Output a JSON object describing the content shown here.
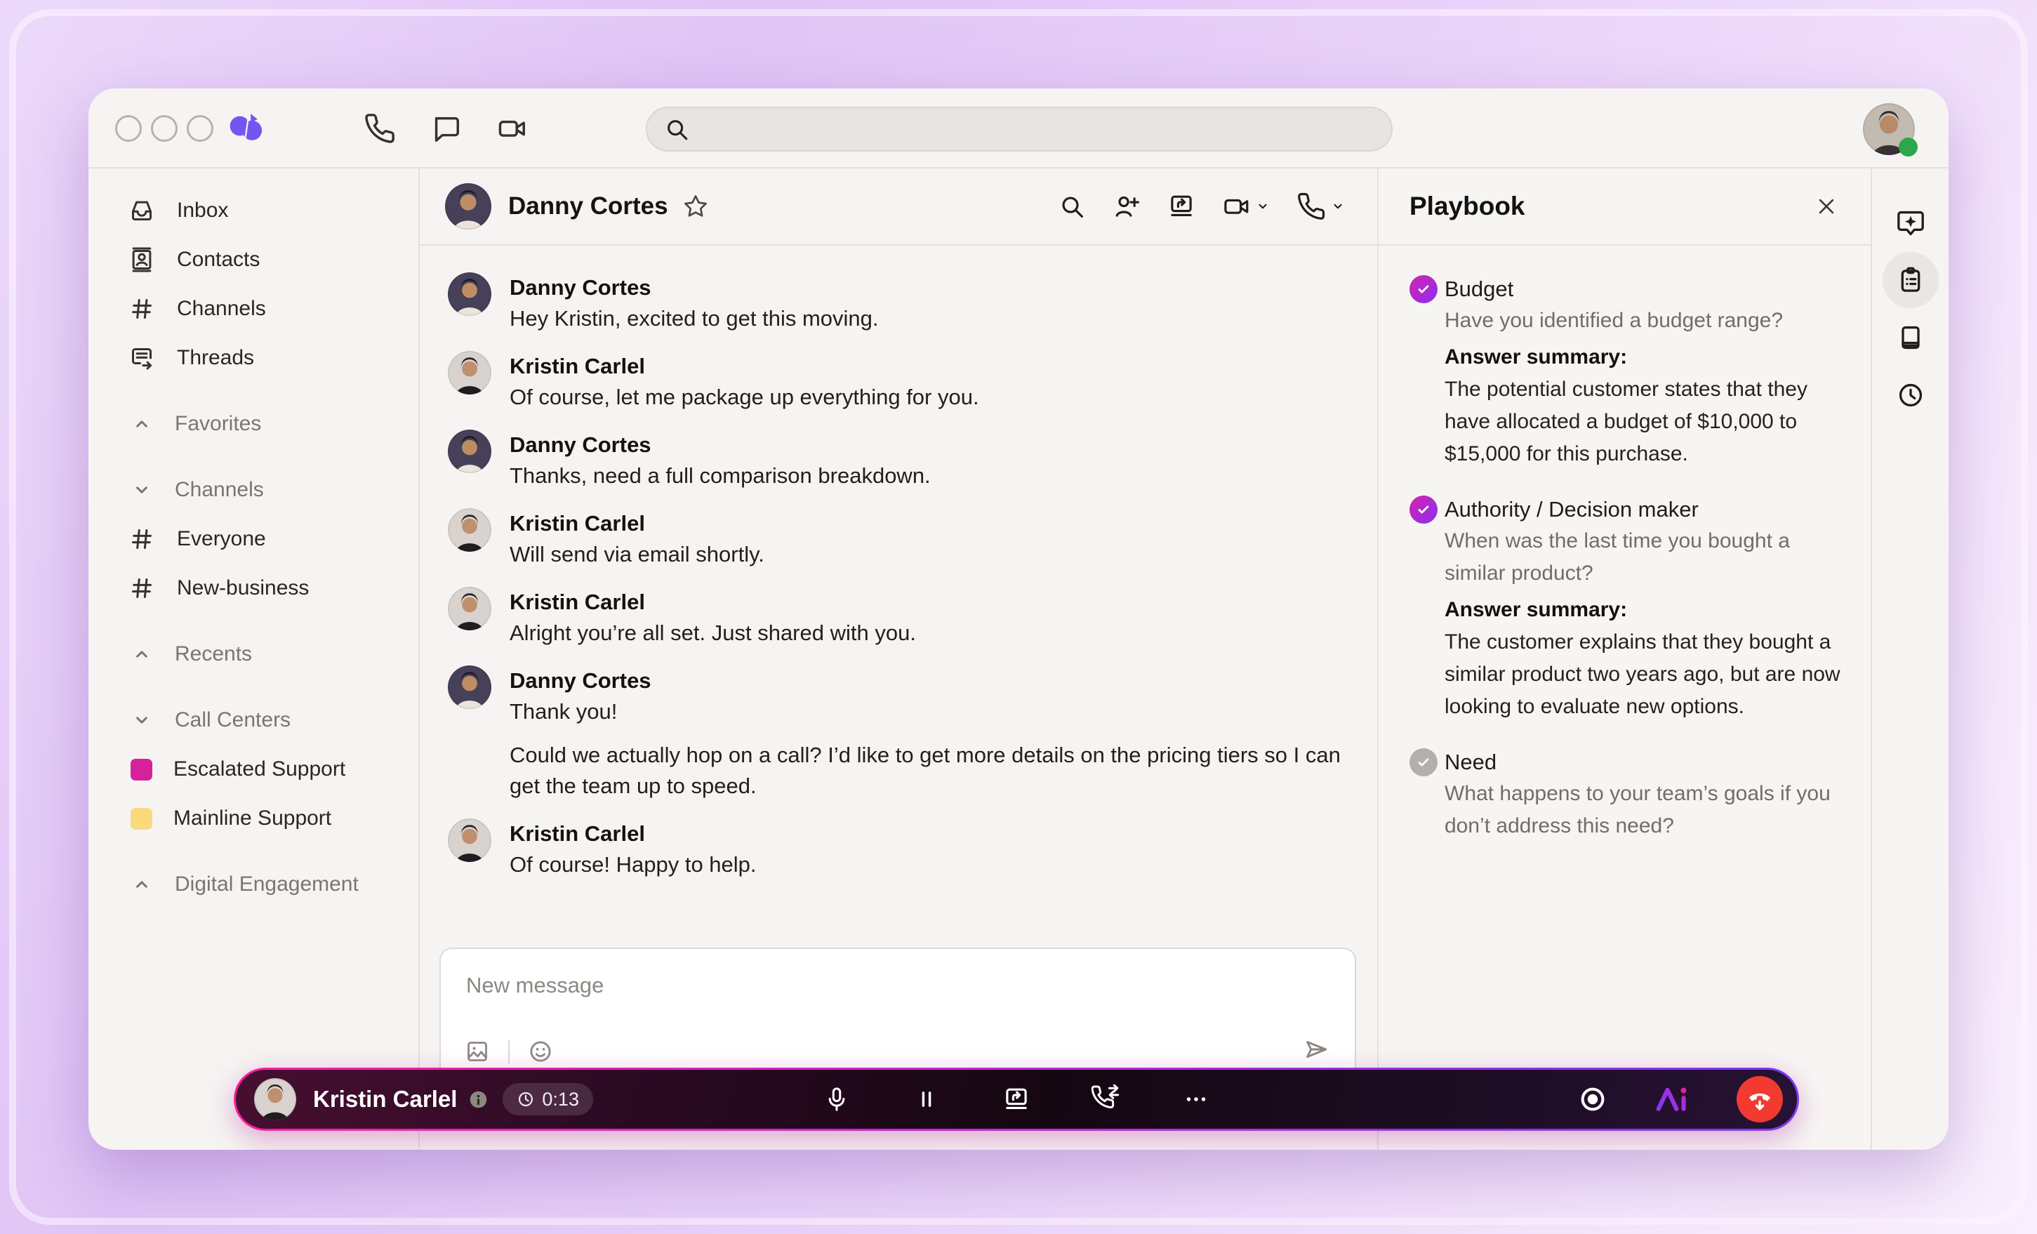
{
  "colors": {
    "accent": "#7356f2",
    "magenta": "#d6219c",
    "yellow": "#fbd97f",
    "presence_green": "#2ba84a",
    "hangup_red": "#f23a31",
    "check_gradient_start": "#d424ae",
    "check_gradient_end": "#8b2ff0",
    "callbar_border_start": "#ff1fa0",
    "callbar_border_end": "#7b3bf5"
  },
  "topbar": {
    "nav_icons": [
      {
        "name": "phone-icon"
      },
      {
        "name": "chat-icon"
      },
      {
        "name": "video-icon"
      }
    ],
    "search": {
      "placeholder": ""
    }
  },
  "sidebar": {
    "items": [
      {
        "type": "link",
        "icon": "inbox-icon",
        "label": "Inbox"
      },
      {
        "type": "link",
        "icon": "contacts-icon",
        "label": "Contacts"
      },
      {
        "type": "link",
        "icon": "hash-icon",
        "label": "Channels"
      },
      {
        "type": "link",
        "icon": "threads-icon",
        "label": "Threads"
      },
      {
        "type": "section",
        "state": "collapsed",
        "label": "Favorites"
      },
      {
        "type": "section",
        "state": "expanded",
        "label": "Channels"
      },
      {
        "type": "link",
        "icon": "hash-icon",
        "label": "Everyone"
      },
      {
        "type": "link",
        "icon": "hash-icon",
        "label": "New-business"
      },
      {
        "type": "section",
        "state": "collapsed",
        "label": "Recents"
      },
      {
        "type": "section",
        "state": "expanded",
        "label": "Call Centers"
      },
      {
        "type": "link",
        "swatch": "#d6219c",
        "label": "Escalated Support"
      },
      {
        "type": "link",
        "swatch": "#fbd97f",
        "label": "Mainline Support"
      },
      {
        "type": "section",
        "state": "collapsed",
        "label": "Digital Engagement"
      }
    ]
  },
  "chat": {
    "header": {
      "name": "Danny Cortes",
      "avatar": "danny"
    },
    "messages": [
      {
        "sender": "Danny Cortes",
        "avatar": "danny",
        "paragraphs": [
          "Hey Kristin, excited to get this moving."
        ]
      },
      {
        "sender": "Kristin Carlel",
        "avatar": "kristin",
        "paragraphs": [
          "Of course, let me package up everything for you."
        ]
      },
      {
        "sender": "Danny Cortes",
        "avatar": "danny",
        "paragraphs": [
          "Thanks, need a full comparison breakdown."
        ]
      },
      {
        "sender": "Kristin Carlel",
        "avatar": "kristin",
        "paragraphs": [
          "Will send via email shortly."
        ]
      },
      {
        "sender": "Kristin Carlel",
        "avatar": "kristin",
        "paragraphs": [
          "Alright you’re all set. Just shared with you."
        ]
      },
      {
        "sender": "Danny Cortes",
        "avatar": "danny",
        "paragraphs": [
          "Thank you!",
          "Could we actually hop on a call? I’d like to get more details on the pricing tiers so I can get the team up to speed."
        ]
      },
      {
        "sender": "Kristin Carlel",
        "avatar": "kristin",
        "paragraphs": [
          "Of course! Happy to help."
        ]
      }
    ],
    "composer": {
      "placeholder": "New message"
    }
  },
  "playbook": {
    "title": "Playbook",
    "items": [
      {
        "status": "done",
        "title": "Budget",
        "question": "Have you identified a budget range?",
        "answer_label": "Answer summary:",
        "answer": "The potential customer states that they have allocated a budget of $10,000 to $15,000 for this purchase."
      },
      {
        "status": "done",
        "title": "Authority / Decision maker",
        "question": "When was the last time you bought a similar product?",
        "answer_label": "Answer summary:",
        "answer": "The customer explains that they bought a similar product two years ago, but are now looking to evaluate new options."
      },
      {
        "status": "pending",
        "title": "Need",
        "question": "What happens to your team’s goals if you don’t address this need?"
      }
    ]
  },
  "rail": {
    "icons": [
      {
        "name": "ai-chat-icon",
        "active": false
      },
      {
        "name": "playbook-icon",
        "active": true
      },
      {
        "name": "notebook-icon",
        "active": false
      },
      {
        "name": "history-icon",
        "active": false
      }
    ]
  },
  "callbar": {
    "participant": {
      "name": "Kristin Carlel",
      "avatar": "kristin"
    },
    "timer": "0:13",
    "controls": [
      {
        "name": "mic-icon"
      },
      {
        "name": "pause-icon"
      },
      {
        "name": "screen-share-icon"
      },
      {
        "name": "call-transfer-icon"
      },
      {
        "name": "more-options-icon"
      }
    ]
  }
}
